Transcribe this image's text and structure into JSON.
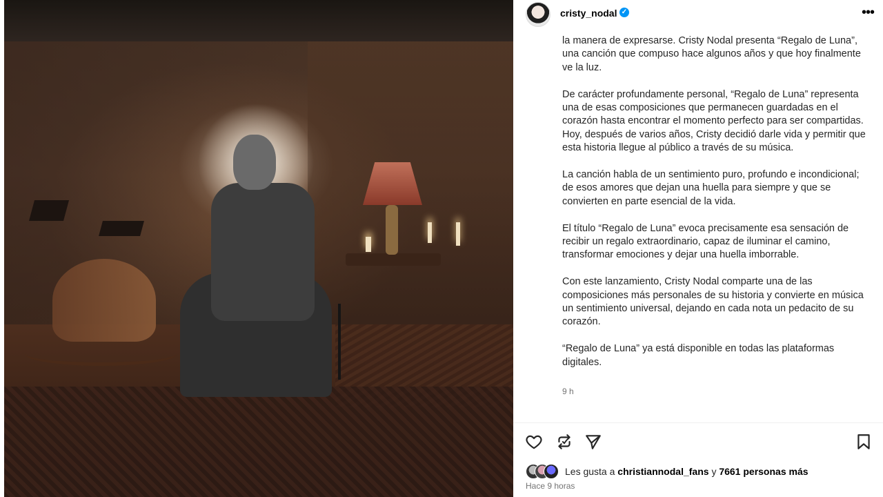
{
  "post": {
    "username": "cristy_nodal",
    "verified": true,
    "caption_paragraphs": [
      "la manera de expresarse. Cristy Nodal presenta “Regalo de Luna”, una canción que compuso hace algunos años y que hoy finalmente ve la luz.",
      "De carácter profundamente personal, “Regalo de Luna” representa una de esas composiciones que permanecen guardadas en el corazón hasta encontrar el momento perfecto para ser compartidas. Hoy, después de varios años, Cristy decidió darle vida y permitir que esta historia llegue al público a través de su música.",
      "La canción habla de un sentimiento puro, profundo e incondicional; de esos amores que dejan una huella para siempre y que se convierten en parte esencial de la vida.",
      "El título “Regalo de Luna” evoca precisamente esa sensación de recibir un regalo extraordinario, capaz de iluminar el camino, transformar emociones y dejar una huella imborrable.",
      "Con este lanzamiento, Cristy Nodal comparte una de las composiciones más personales de su historia y convierte en música un sentimiento universal, dejando en cada nota un pedacito de su corazón.",
      "“Regalo de Luna” ya está disponible en todas las plataformas digitales."
    ],
    "caption_time": "9 h",
    "likes": {
      "prefix": "Les gusta a",
      "user": "christiannodal_fans",
      "middle": "y",
      "count_text": "7661 personas más"
    },
    "posted_ago": "Hace 9 horas"
  },
  "icons": {
    "more": "more-options-icon",
    "like": "heart-icon",
    "comment": "comment-icon",
    "repost": "repost-icon",
    "share": "share-icon",
    "save": "bookmark-icon"
  },
  "colors": {
    "verified": "#0095f6",
    "text": "#262626",
    "muted": "#737373"
  }
}
